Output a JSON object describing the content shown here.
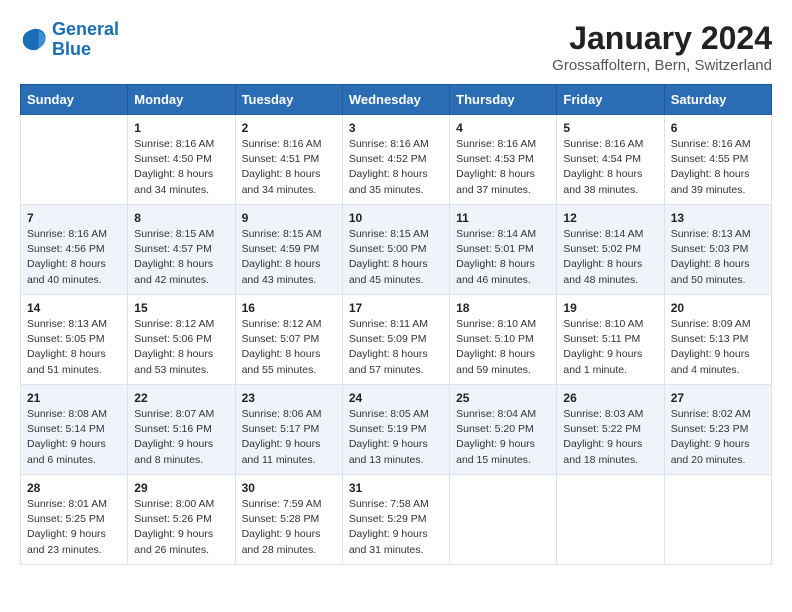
{
  "logo": {
    "line1": "General",
    "line2": "Blue"
  },
  "title": "January 2024",
  "subtitle": "Grossaffoltern, Bern, Switzerland",
  "days_header": [
    "Sunday",
    "Monday",
    "Tuesday",
    "Wednesday",
    "Thursday",
    "Friday",
    "Saturday"
  ],
  "weeks": [
    [
      {
        "day": "",
        "info": ""
      },
      {
        "day": "1",
        "info": "Sunrise: 8:16 AM\nSunset: 4:50 PM\nDaylight: 8 hours\nand 34 minutes."
      },
      {
        "day": "2",
        "info": "Sunrise: 8:16 AM\nSunset: 4:51 PM\nDaylight: 8 hours\nand 34 minutes."
      },
      {
        "day": "3",
        "info": "Sunrise: 8:16 AM\nSunset: 4:52 PM\nDaylight: 8 hours\nand 35 minutes."
      },
      {
        "day": "4",
        "info": "Sunrise: 8:16 AM\nSunset: 4:53 PM\nDaylight: 8 hours\nand 37 minutes."
      },
      {
        "day": "5",
        "info": "Sunrise: 8:16 AM\nSunset: 4:54 PM\nDaylight: 8 hours\nand 38 minutes."
      },
      {
        "day": "6",
        "info": "Sunrise: 8:16 AM\nSunset: 4:55 PM\nDaylight: 8 hours\nand 39 minutes."
      }
    ],
    [
      {
        "day": "7",
        "info": "Sunrise: 8:16 AM\nSunset: 4:56 PM\nDaylight: 8 hours\nand 40 minutes."
      },
      {
        "day": "8",
        "info": "Sunrise: 8:15 AM\nSunset: 4:57 PM\nDaylight: 8 hours\nand 42 minutes."
      },
      {
        "day": "9",
        "info": "Sunrise: 8:15 AM\nSunset: 4:59 PM\nDaylight: 8 hours\nand 43 minutes."
      },
      {
        "day": "10",
        "info": "Sunrise: 8:15 AM\nSunset: 5:00 PM\nDaylight: 8 hours\nand 45 minutes."
      },
      {
        "day": "11",
        "info": "Sunrise: 8:14 AM\nSunset: 5:01 PM\nDaylight: 8 hours\nand 46 minutes."
      },
      {
        "day": "12",
        "info": "Sunrise: 8:14 AM\nSunset: 5:02 PM\nDaylight: 8 hours\nand 48 minutes."
      },
      {
        "day": "13",
        "info": "Sunrise: 8:13 AM\nSunset: 5:03 PM\nDaylight: 8 hours\nand 50 minutes."
      }
    ],
    [
      {
        "day": "14",
        "info": "Sunrise: 8:13 AM\nSunset: 5:05 PM\nDaylight: 8 hours\nand 51 minutes."
      },
      {
        "day": "15",
        "info": "Sunrise: 8:12 AM\nSunset: 5:06 PM\nDaylight: 8 hours\nand 53 minutes."
      },
      {
        "day": "16",
        "info": "Sunrise: 8:12 AM\nSunset: 5:07 PM\nDaylight: 8 hours\nand 55 minutes."
      },
      {
        "day": "17",
        "info": "Sunrise: 8:11 AM\nSunset: 5:09 PM\nDaylight: 8 hours\nand 57 minutes."
      },
      {
        "day": "18",
        "info": "Sunrise: 8:10 AM\nSunset: 5:10 PM\nDaylight: 8 hours\nand 59 minutes."
      },
      {
        "day": "19",
        "info": "Sunrise: 8:10 AM\nSunset: 5:11 PM\nDaylight: 9 hours\nand 1 minute."
      },
      {
        "day": "20",
        "info": "Sunrise: 8:09 AM\nSunset: 5:13 PM\nDaylight: 9 hours\nand 4 minutes."
      }
    ],
    [
      {
        "day": "21",
        "info": "Sunrise: 8:08 AM\nSunset: 5:14 PM\nDaylight: 9 hours\nand 6 minutes."
      },
      {
        "day": "22",
        "info": "Sunrise: 8:07 AM\nSunset: 5:16 PM\nDaylight: 9 hours\nand 8 minutes."
      },
      {
        "day": "23",
        "info": "Sunrise: 8:06 AM\nSunset: 5:17 PM\nDaylight: 9 hours\nand 11 minutes."
      },
      {
        "day": "24",
        "info": "Sunrise: 8:05 AM\nSunset: 5:19 PM\nDaylight: 9 hours\nand 13 minutes."
      },
      {
        "day": "25",
        "info": "Sunrise: 8:04 AM\nSunset: 5:20 PM\nDaylight: 9 hours\nand 15 minutes."
      },
      {
        "day": "26",
        "info": "Sunrise: 8:03 AM\nSunset: 5:22 PM\nDaylight: 9 hours\nand 18 minutes."
      },
      {
        "day": "27",
        "info": "Sunrise: 8:02 AM\nSunset: 5:23 PM\nDaylight: 9 hours\nand 20 minutes."
      }
    ],
    [
      {
        "day": "28",
        "info": "Sunrise: 8:01 AM\nSunset: 5:25 PM\nDaylight: 9 hours\nand 23 minutes."
      },
      {
        "day": "29",
        "info": "Sunrise: 8:00 AM\nSunset: 5:26 PM\nDaylight: 9 hours\nand 26 minutes."
      },
      {
        "day": "30",
        "info": "Sunrise: 7:59 AM\nSunset: 5:28 PM\nDaylight: 9 hours\nand 28 minutes."
      },
      {
        "day": "31",
        "info": "Sunrise: 7:58 AM\nSunset: 5:29 PM\nDaylight: 9 hours\nand 31 minutes."
      },
      {
        "day": "",
        "info": ""
      },
      {
        "day": "",
        "info": ""
      },
      {
        "day": "",
        "info": ""
      }
    ]
  ]
}
